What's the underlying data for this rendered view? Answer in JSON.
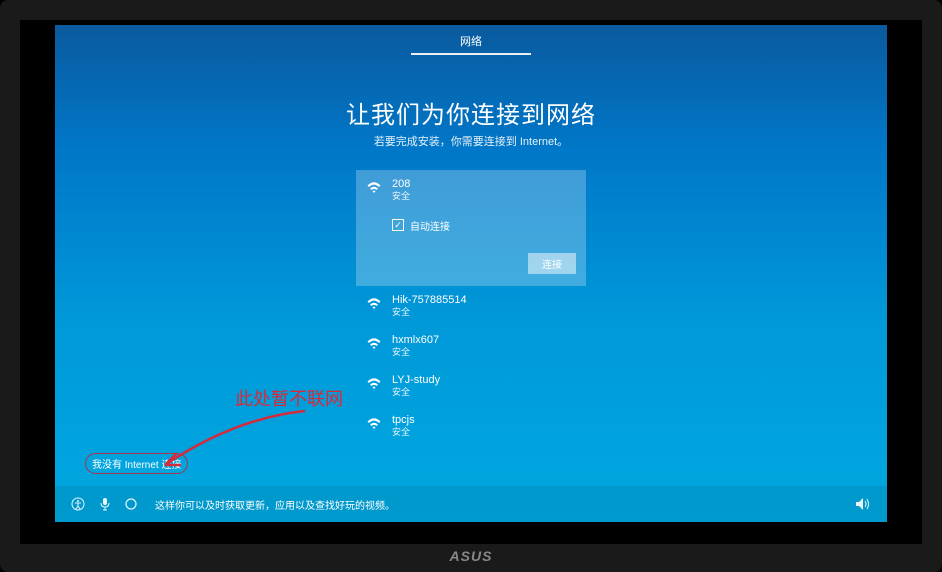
{
  "header": {
    "tab": "网络"
  },
  "title": "让我们为你连接到网络",
  "subtitle": "若要完成安装，你需要连接到 Internet。",
  "networks": [
    {
      "name": "208",
      "security": "安全",
      "selected": true,
      "auto_connect_label": "自动连接",
      "connect_button": "连接"
    },
    {
      "name": "Hik-757885514",
      "security": "安全"
    },
    {
      "name": "hxmlx607",
      "security": "安全"
    },
    {
      "name": "LYJ-study",
      "security": "安全"
    },
    {
      "name": "tpcjs",
      "security": "安全"
    }
  ],
  "no_internet_link": "我没有 Internet 连接",
  "annotation": "此处暂不联网",
  "bottom_tip": "这样你可以及时获取更新，应用以及查找好玩的视频。",
  "monitor_brand": "ASUS"
}
